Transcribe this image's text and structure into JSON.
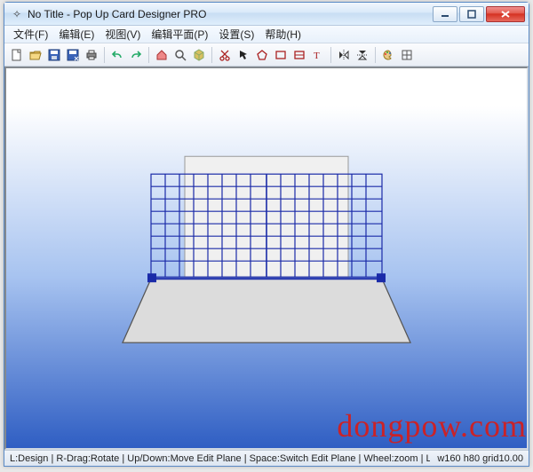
{
  "title": "No Title - Pop Up Card Designer PRO",
  "menus": {
    "file": "文件(F)",
    "edit": "编辑(E)",
    "view": "视图(V)",
    "editplane": "编辑平面(P)",
    "settings": "设置(S)",
    "help": "帮助(H)"
  },
  "status": {
    "hints": "L:Design | R-Drag:Rotate | Up/Down:Move Edit Plane | Space:Switch Edit Plane | Wheel:zoom | Left/Right Move Mirror",
    "dims": "w160 h80 grid10.00"
  },
  "watermark": "dongpow.com",
  "icons": {
    "new": "new",
    "open": "open",
    "save": "save",
    "save2": "save-as",
    "print": "print",
    "undo": "undo",
    "redo": "redo",
    "home": "reset-view",
    "zoom": "zoom",
    "view3d": "view-3d",
    "cut": "cut",
    "select": "select",
    "poly": "polygon",
    "rect": "rectangle",
    "rect2": "rectangle-2",
    "text": "text",
    "mirrorh": "mirror-h",
    "mirrorv": "mirror-v",
    "palette": "palette",
    "grid": "grid-toggle"
  },
  "colors": {
    "accent": "#2f5ec3",
    "grid": "#1a2aa8",
    "card": "#e8e8e8",
    "close": "#d42e1f"
  }
}
